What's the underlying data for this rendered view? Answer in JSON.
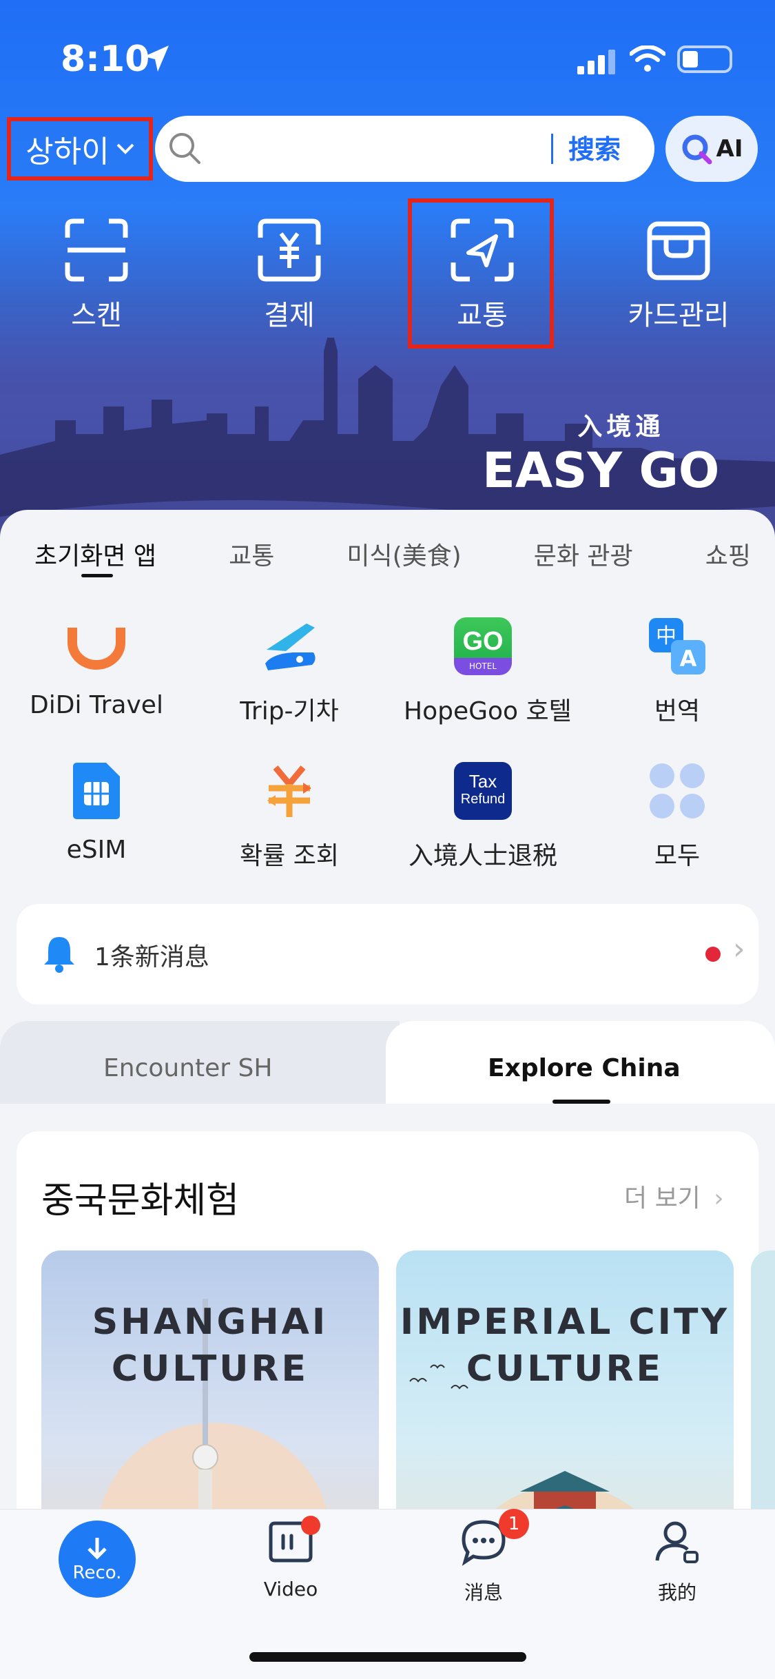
{
  "status_bar": {
    "time": "8:10"
  },
  "header": {
    "city": "상하이",
    "search_button": "搜索",
    "ai_label": "AI"
  },
  "quick_actions": [
    {
      "label": "스캔",
      "icon": "scan-icon"
    },
    {
      "label": "결제",
      "icon": "payment-icon"
    },
    {
      "label": "교통",
      "icon": "transport-icon"
    },
    {
      "label": "카드관리",
      "icon": "card-manage-icon"
    }
  ],
  "banner": {
    "cn": "入境通",
    "en": "EASY GO"
  },
  "category_tabs": [
    "초기화면 앱",
    "교통",
    "미식(美食)",
    "문화 관광",
    "쇼핑"
  ],
  "apps": [
    {
      "label": "DiDi Travel",
      "icon": "didi-icon"
    },
    {
      "label": "Trip-기차",
      "icon": "train-icon"
    },
    {
      "label": "HopeGoo 호텔",
      "icon": "hopegoo-icon",
      "badge": "HOTEL"
    },
    {
      "label": "번역",
      "icon": "translate-icon"
    },
    {
      "label": "eSIM",
      "icon": "esim-icon"
    },
    {
      "label": "확률 조회",
      "icon": "exchange-rate-icon"
    },
    {
      "label": "入境人士退税",
      "icon": "tax-refund-icon",
      "icon_text": [
        "Tax",
        "Refund"
      ]
    },
    {
      "label": "모두",
      "icon": "all-apps-icon"
    }
  ],
  "notice": {
    "text": "1条新消息"
  },
  "segments": {
    "left": "Encounter SH",
    "right": "Explore China"
  },
  "culture": {
    "title": "중국문화체험",
    "more": "더 보기",
    "cards": [
      {
        "title_line1": "SHANGHAI",
        "title_line2": "CULTURE"
      },
      {
        "title_line1": "IMPERIAL CITY",
        "title_line2": "CULTURE"
      }
    ]
  },
  "tabbar": {
    "reco": "Reco.",
    "video": "Video",
    "messages": "消息",
    "messages_badge": "1",
    "me": "我的"
  },
  "colors": {
    "brand_blue": "#1f6ef5",
    "highlight_red": "#e3261c",
    "badge_red": "#f03a2c"
  }
}
